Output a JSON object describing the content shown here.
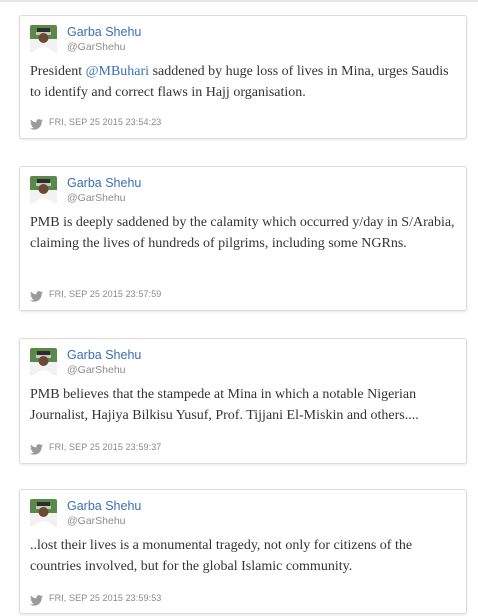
{
  "colors": {
    "link": "#3a6fb3",
    "muted": "#8c8c8c",
    "text": "#333333",
    "border": "#dcdcdc"
  },
  "icons": {
    "avatar": "avatar-photo",
    "meta": "twitter-bird-icon"
  },
  "tweets": [
    {
      "author": {
        "name": "Garba Shehu",
        "handle": "@GarShehu"
      },
      "text_before": "President ",
      "mention": "@MBuhari",
      "text_after": " saddened by huge loss of lives in Mina, urges Saudis to identify and correct flaws in Hajj organisation.",
      "timestamp": "FRI, SEP 25 2015 23:54:23"
    },
    {
      "author": {
        "name": "Garba Shehu",
        "handle": "@GarShehu"
      },
      "text": "PMB is deeply saddened by the calamity which occurred y/day in S/Arabia, claiming the lives of hundreds of pilgrims, including some NGRns.",
      "timestamp": "FRI, SEP 25 2015 23:57:59"
    },
    {
      "author": {
        "name": "Garba Shehu",
        "handle": "@GarShehu"
      },
      "text": "PMB believes that the stampede at Mina in which a notable Nigerian Journalist, Hajiya Bilkisu Yusuf, Prof. Tijjani El-Miskin and others....",
      "timestamp": "FRI, SEP 25 2015 23:59:37"
    },
    {
      "author": {
        "name": "Garba Shehu",
        "handle": "@GarShehu"
      },
      "text": "..lost their lives is a monumental tragedy, not only for citizens of the countries involved, but for the global Islamic community.",
      "timestamp": "FRI, SEP 25 2015 23:59:53"
    }
  ]
}
